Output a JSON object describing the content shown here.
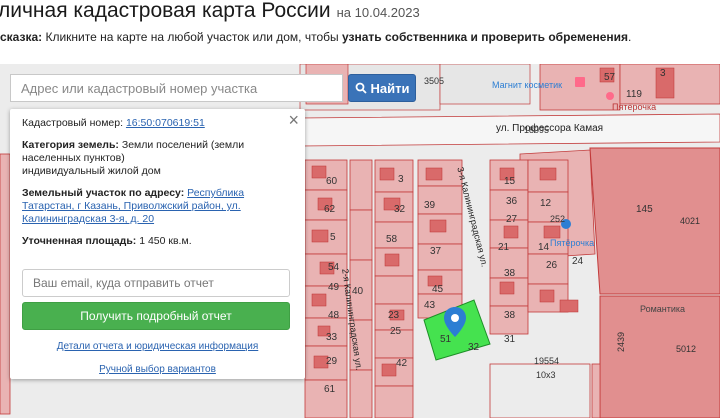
{
  "header": {
    "title": "личная кадастровая карта России",
    "date": "на 10.04.2023"
  },
  "hint": {
    "prefix": "сказка:",
    "text": "Кликните на карте на любой участок или дом, чтобы",
    "bold": "узнать собственника и проверить обременения",
    "suffix": "."
  },
  "search": {
    "placeholder": "Адрес или кадастровый номер участка",
    "value": "",
    "button_label": "Найти"
  },
  "panel": {
    "close_label": "×",
    "cad_label": "Кадастровый номер:",
    "cad_value": "16:50:070619:51",
    "cat_label": "Категория земель:",
    "cat_value": "Земли поселений (земли населенных пунктов)",
    "use_value": "индивидуальный жилой дом",
    "addr_label": "Земельный участок по адресу:",
    "addr_value": "Республика Татарстан, г Казань, Приволжский район, ул. Калининградская 3-я, д. 20",
    "area_label": "Уточненная площадь:",
    "area_value": "1 450 кв.м.",
    "email_placeholder": "Ваш email, куда отправить отчет",
    "cta_label": "Получить подробный отчет",
    "details_link": "Детали отчета и юридическая информация",
    "manual_link": "Ручной выбор вариантов"
  },
  "map": {
    "streets": {
      "kamaya": "ул. Профессора Камая",
      "kalin2": "2-я Калининградская ул.",
      "kalin3": "3-я Калининградская ул."
    },
    "pois": {
      "magnit": "Магнит косметик",
      "pyat1": "Пятёрочка",
      "pyat2": "Пятёрочка",
      "romantika": "Романтика"
    },
    "labels": {
      "n3505": "3505",
      "n57": "57",
      "n119": "119",
      "n3": "3",
      "n18095": "18095",
      "n145": "145",
      "n4021": "4021",
      "n60": "60",
      "n62": "62",
      "n32": "32",
      "n3b": "3",
      "n39": "39",
      "n58": "58",
      "n5": "5",
      "n54": "54",
      "n49": "49",
      "n37": "37",
      "n45": "45",
      "n48": "48",
      "n43": "43",
      "n33": "33",
      "n29": "29",
      "n25": "25",
      "n23": "23",
      "n38": "38",
      "n36": "36",
      "n15": "15",
      "n12": "12",
      "n27": "27",
      "n51": "51",
      "n32b": "32",
      "n42": "42",
      "n19554": "19554",
      "n10x3": "10х3",
      "n5012": "5012",
      "n2439": "2439",
      "n21": "21",
      "n24": "24",
      "n14": "14",
      "n61": "61",
      "n26": "26",
      "n252": "252",
      "n40": "40",
      "n38b": "38",
      "n31": "31"
    },
    "colors": {
      "background": "#ececec",
      "parcel_fill": "#e9b3b3",
      "parcel_stroke": "#c23a3a",
      "selected_fill": "#45e24f",
      "marker": "#2c7ed3",
      "building": "#d96a6a"
    },
    "marker_icon": "map-pin-icon",
    "search_icon": "magnifier-icon",
    "close_icon": "close-icon",
    "shop_icon": "shopping-bag-icon"
  }
}
